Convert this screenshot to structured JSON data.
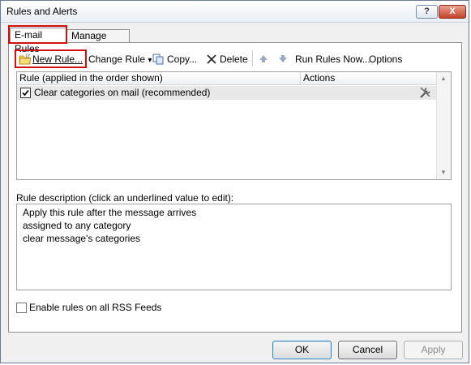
{
  "window": {
    "title": "Rules and Alerts",
    "help_glyph": "?",
    "close_glyph": "X"
  },
  "tabs": [
    {
      "label": "E-mail Rules",
      "selected": true
    },
    {
      "label": "Manage Alerts",
      "selected": false
    }
  ],
  "toolbar": {
    "new_rule": {
      "label": "New Rule...",
      "accesskey": "N"
    },
    "change_rule": {
      "label": "Change Rule",
      "accesskey": "h",
      "dropdown_glyph": "▾"
    },
    "copy": {
      "label": "Copy...",
      "accesskey": "p"
    },
    "delete": {
      "label": "Delete",
      "accesskey": "D"
    },
    "run_rules_now": {
      "label": "Run Rules Now...",
      "accesskey": "R"
    },
    "options": {
      "label": "Options",
      "accesskey": "O"
    }
  },
  "rules_list": {
    "columns": [
      "Rule (applied in the order shown)",
      "Actions"
    ],
    "rows": [
      {
        "name": "Clear categories on mail (recommended)",
        "checked": true,
        "action_icon": "tools-icon"
      }
    ]
  },
  "description": {
    "label": "Rule description (click an underlined value to edit):",
    "lines": [
      "Apply this rule after the message arrives",
      "assigned to any category",
      "clear message's categories"
    ]
  },
  "rss": {
    "label": "Enable rules on all RSS Feeds",
    "checked": false
  },
  "buttons": {
    "ok": "OK",
    "cancel": "Cancel",
    "apply": "Apply"
  },
  "colors": {
    "highlight": "#d20f0f",
    "selection_row": "#e8e8e8"
  }
}
